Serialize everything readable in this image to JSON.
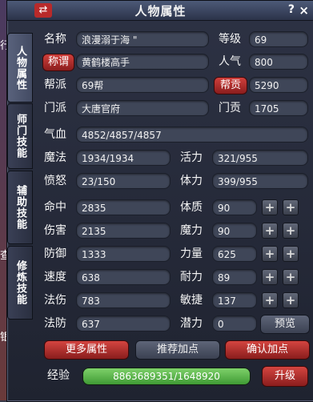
{
  "window": {
    "title": "人物属性",
    "swap_icon": "⇄",
    "help_label": "?",
    "close_label": "×"
  },
  "left_edge": {
    "item_top": "行",
    "item_mid": "查",
    "item_bot": "银"
  },
  "tabs": [
    {
      "label": "人物属性"
    },
    {
      "label": "师门技能"
    },
    {
      "label": "辅助技能"
    },
    {
      "label": "修炼技能"
    }
  ],
  "profile": {
    "name_label": "名称",
    "name_value": "浪漫溺于海 \"",
    "level_label": "等级",
    "level_value": "69",
    "title_button": "称谓",
    "title_value": "黄鹤楼高手",
    "popularity_label": "人气",
    "popularity_value": "800",
    "guild_label": "帮派",
    "guild_value": "69帮",
    "guild_contrib_button": "帮贡",
    "guild_contrib_value": "5290",
    "sect_label": "门派",
    "sect_value": "大唐官府",
    "sect_contrib_label": "门贡",
    "sect_contrib_value": "1705"
  },
  "vitals": {
    "hp_label": "气血",
    "hp_value": "4852/4857/4857",
    "mp_label": "魔法",
    "mp_value": "1934/1934",
    "vitality_label": "活力",
    "vitality_value": "321/955",
    "rage_label": "愤怒",
    "rage_value": "23/150",
    "stamina_label": "体力",
    "stamina_value": "399/955"
  },
  "combat": [
    {
      "label": "命中",
      "value": "2835"
    },
    {
      "label": "伤害",
      "value": "2135"
    },
    {
      "label": "防御",
      "value": "1333"
    },
    {
      "label": "速度",
      "value": "638"
    },
    {
      "label": "法伤",
      "value": "783"
    },
    {
      "label": "法防",
      "value": "637"
    }
  ],
  "attributes": [
    {
      "label": "体质",
      "value": "90",
      "plus": "+"
    },
    {
      "label": "魔力",
      "value": "90",
      "plus": "+"
    },
    {
      "label": "力量",
      "value": "625",
      "plus": "+"
    },
    {
      "label": "耐力",
      "value": "89",
      "plus": "+"
    },
    {
      "label": "敏捷",
      "value": "137",
      "plus": "+"
    }
  ],
  "potential": {
    "label": "潜力",
    "value": "0",
    "preview_button": "预览"
  },
  "buttons": {
    "more_attributes": "更多属性",
    "recommend_points": "推荐加点",
    "confirm_points": "确认加点",
    "upgrade": "升级"
  },
  "experience": {
    "label": "经验",
    "value": "8863689351/1648920",
    "fill_fraction": 1.0
  },
  "colors": {
    "accent_red": "#c0302c",
    "exp_green": "#5fb84a",
    "panel": "#2d3244"
  }
}
